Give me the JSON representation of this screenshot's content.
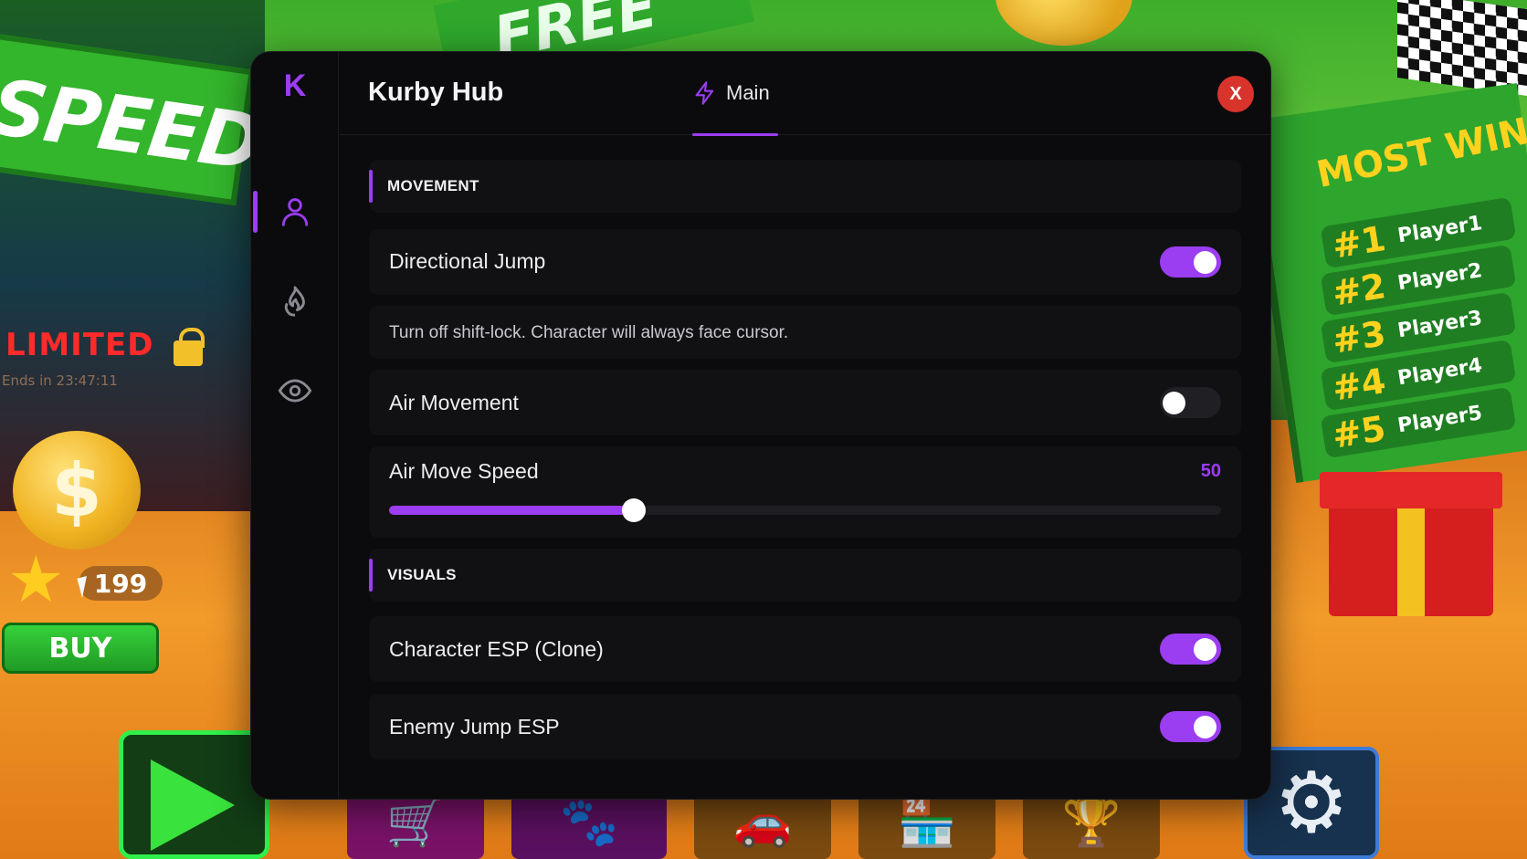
{
  "background": {
    "top_banner": "FREE",
    "speed_banner": "SPEED",
    "limited_label": "LIMITED",
    "ends_text": "Ends in 23:47:11",
    "coin_symbol": "$",
    "star_count": "199",
    "buy_label": "BUY",
    "leaderboard": {
      "title": "MOST WIN",
      "entries": [
        {
          "rank": "#1",
          "name": "Player1"
        },
        {
          "rank": "#2",
          "name": "Player2"
        },
        {
          "rank": "#3",
          "name": "Player3"
        },
        {
          "rank": "#4",
          "name": "Player4"
        },
        {
          "rank": "#5",
          "name": "Player5"
        }
      ]
    },
    "dock_icons": [
      "play-icon",
      "cart-icon",
      "paw-icon",
      "car-icon",
      "shop-icon",
      "trophy-icon",
      "gear-icon"
    ]
  },
  "hub": {
    "logo": "K",
    "title": "Kurby Hub",
    "accent_color": "#9b3df1",
    "close_label": "X",
    "close_color": "#d8342c",
    "tabs": [
      {
        "label": "Main",
        "icon": "lightning-icon",
        "active": true
      }
    ],
    "sidebar": [
      {
        "icon": "user-icon",
        "active": true
      },
      {
        "icon": "flame-icon",
        "active": false
      },
      {
        "icon": "eye-icon",
        "active": false
      }
    ],
    "sections": {
      "movement": {
        "label": "MOVEMENT",
        "directional_jump": {
          "label": "Directional Jump",
          "enabled": true
        },
        "description": "Turn off shift-lock. Character will always face cursor.",
        "air_movement": {
          "label": "Air Movement",
          "enabled": false
        },
        "air_move_speed": {
          "label": "Air Move Speed",
          "value": "50",
          "min": 0,
          "max": 170
        }
      },
      "visuals": {
        "label": "VISUALS",
        "character_esp": {
          "label": "Character ESP (Clone)",
          "enabled": true
        },
        "enemy_jump_esp": {
          "label": "Enemy Jump ESP",
          "enabled": true
        }
      }
    }
  }
}
